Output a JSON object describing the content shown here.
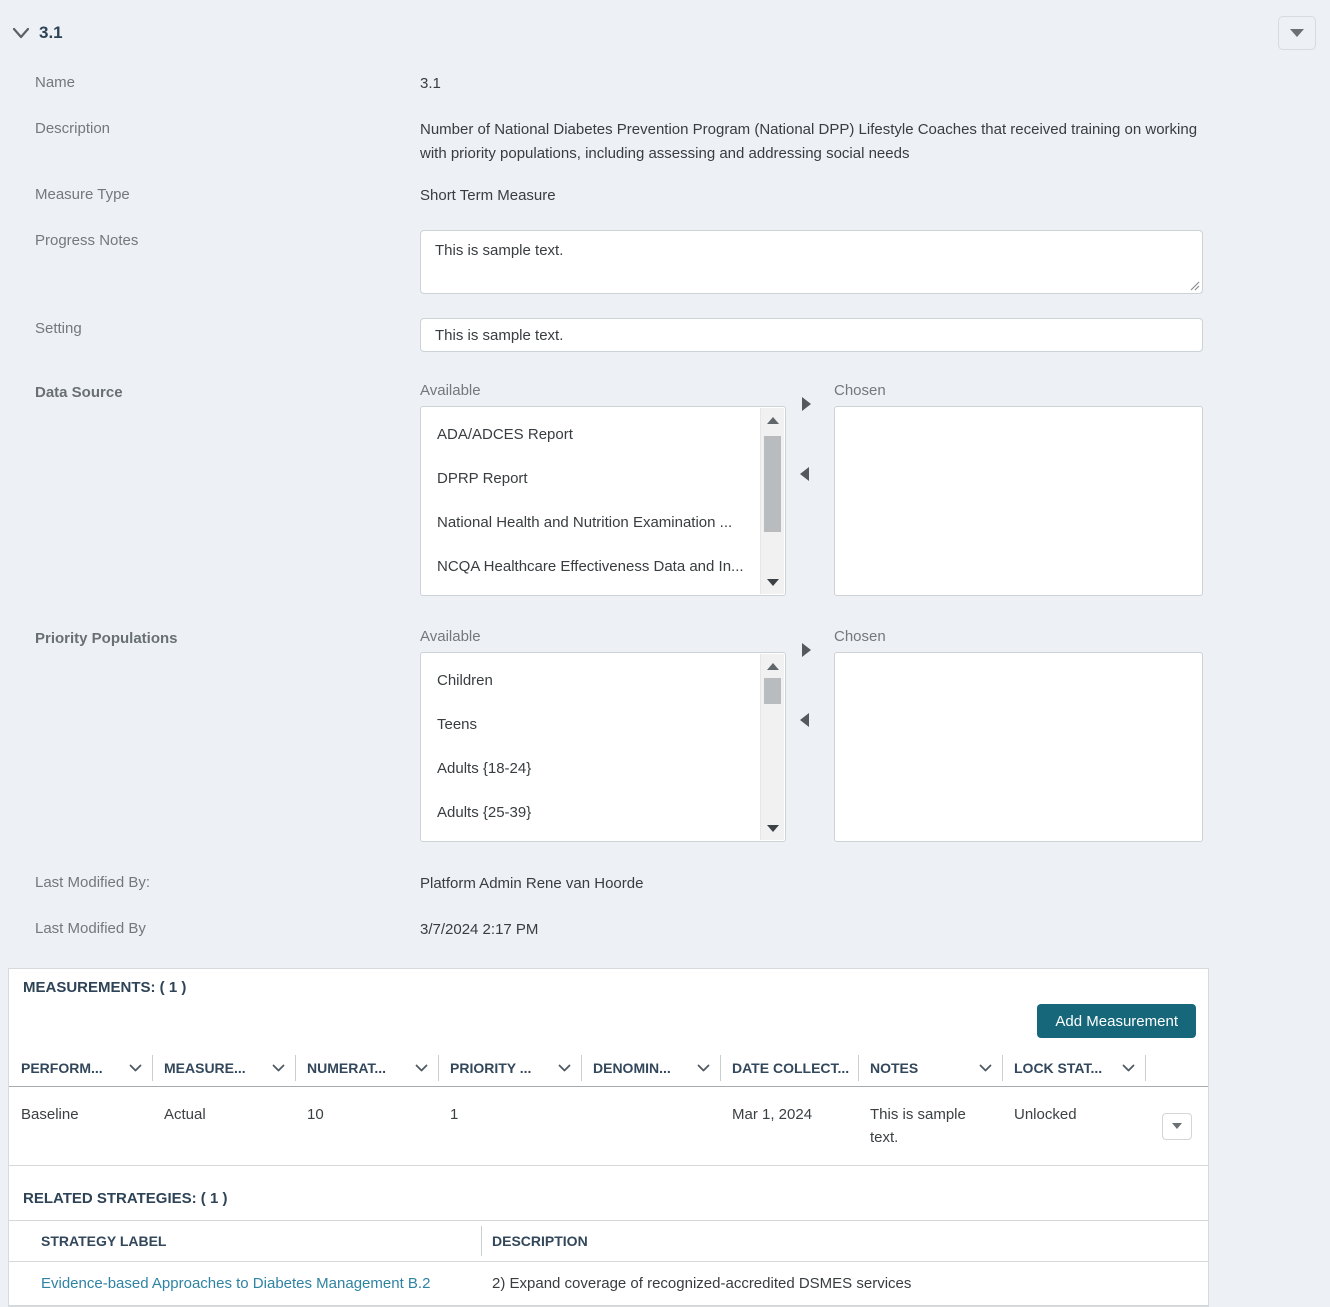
{
  "header": {
    "title": "3.1"
  },
  "form": {
    "name": {
      "label": "Name",
      "value": "3.1"
    },
    "description": {
      "label": "Description",
      "value": "Number of National Diabetes Prevention Program (National DPP) Lifestyle Coaches that received training on working with priority populations, including assessing and addressing social needs"
    },
    "measure_type": {
      "label": "Measure Type",
      "value": "Short Term Measure"
    },
    "progress_notes": {
      "label": "Progress Notes",
      "value": "This is sample text."
    },
    "setting": {
      "label": "Setting",
      "value": "This is sample text."
    },
    "data_source": {
      "label": "Data Source",
      "available_label": "Available",
      "chosen_label": "Chosen",
      "available_items": [
        "ADA/ADCES Report",
        "DPRP Report",
        "National Health and Nutrition Examination ...",
        "NCQA Healthcare Effectiveness Data and In..."
      ],
      "chosen_items": []
    },
    "priority_populations": {
      "label": "Priority Populations",
      "available_label": "Available",
      "chosen_label": "Chosen",
      "available_items": [
        "Children",
        "Teens",
        "Adults {18-24}",
        "Adults {25-39}"
      ],
      "chosen_items": []
    },
    "last_modified_by_user": {
      "label": "Last Modified By:",
      "value": "Platform Admin Rene van Hoorde"
    },
    "last_modified_by_date": {
      "label": "Last Modified By",
      "value": "3/7/2024 2:17 PM"
    }
  },
  "measurements": {
    "heading": "MEASUREMENTS: ( 1 )",
    "add_button": "Add Measurement",
    "columns": [
      {
        "label": "PERFORM..."
      },
      {
        "label": "MEASURE..."
      },
      {
        "label": "NUMERAT..."
      },
      {
        "label": "PRIORITY ..."
      },
      {
        "label": "DENOMIN..."
      },
      {
        "label": "DATE COLLECT..."
      },
      {
        "label": "NOTES"
      },
      {
        "label": "LOCK STAT..."
      }
    ],
    "row": {
      "performance": "Baseline",
      "measure": "Actual",
      "numerator": "10",
      "priority": "1",
      "denominator": "",
      "date_collected": "Mar 1, 2024",
      "notes": "This is sample text.",
      "lock_status": "Unlocked"
    }
  },
  "related_strategies": {
    "heading": "RELATED STRATEGIES: ( 1 )",
    "columns": [
      {
        "label": "STRATEGY LABEL"
      },
      {
        "label": "DESCRIPTION"
      }
    ],
    "row": {
      "strategy_label": "Evidence-based Approaches to Diabetes Management B.2",
      "description": "2) Expand coverage of recognized-accredited DSMES services"
    }
  },
  "colors": {
    "accent": "#16677a",
    "link": "#2e83a3",
    "background": "#edf1f5"
  }
}
